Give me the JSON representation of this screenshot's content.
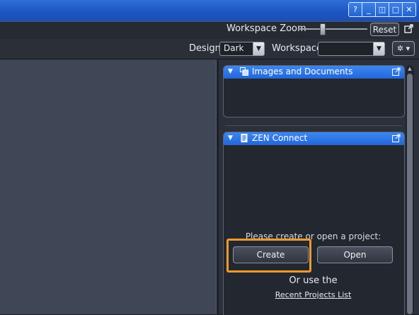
{
  "titlebar": {
    "buttons": [
      {
        "name": "help-button",
        "label": "?"
      },
      {
        "name": "minimize-button",
        "label": "_"
      },
      {
        "name": "tile-button",
        "label": "◫"
      },
      {
        "name": "maximize-button",
        "label": "□"
      },
      {
        "name": "close-button",
        "label": "✕"
      }
    ],
    "accent": "#2364cf"
  },
  "toolbar": {
    "zoom_label": "Workspace Zoom",
    "reset_label": "Reset",
    "design_label": "Design",
    "design_value": "Dark",
    "workspace_label": "Workspace",
    "workspace_value": ""
  },
  "panels": {
    "images_docs": {
      "title": "Images and Documents"
    },
    "zen_connect": {
      "title": "ZEN Connect",
      "prompt": "Please create or open a project:",
      "create_label": "Create",
      "open_label": "Open",
      "or_use": "Or use the",
      "recent_link": "Recent Projects List"
    }
  },
  "highlight_color": "#f29a2e",
  "icons": [
    "help-icon",
    "minimize-icon",
    "tile-icon",
    "maximize-icon",
    "close-icon",
    "popout-icon",
    "gear-icon",
    "collapse-triangle-icon",
    "images-icon",
    "document-icon",
    "external-icon"
  ]
}
